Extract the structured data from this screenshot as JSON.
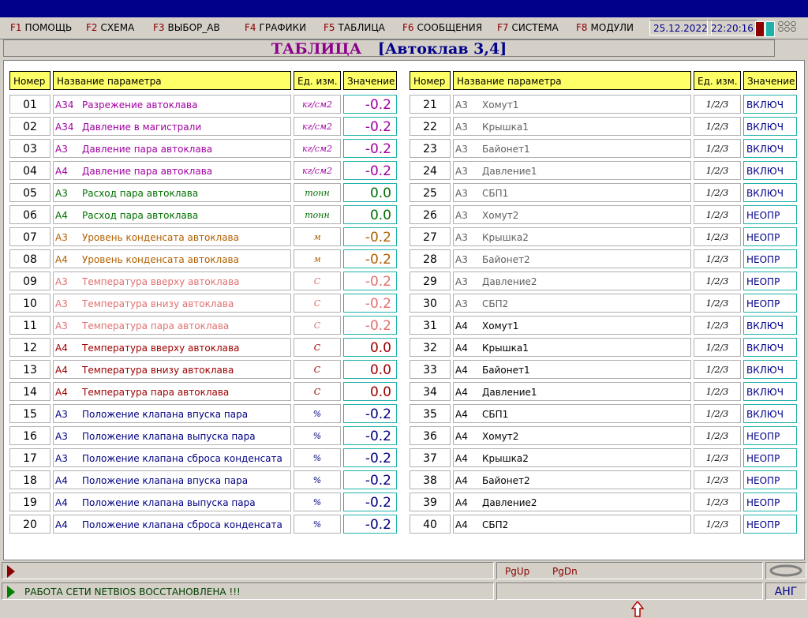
{
  "menu": {
    "items": [
      {
        "key": "F1",
        "label": "ПОМОЩЬ"
      },
      {
        "key": "F2",
        "label": "СХЕМА"
      },
      {
        "key": "F3",
        "label": "ВЫБОР_АВ"
      },
      {
        "key": "F4",
        "label": "ГРАФИКИ"
      },
      {
        "key": "F5",
        "label": "ТАБЛИЦА"
      },
      {
        "key": "F6",
        "label": "СООБЩЕНИЯ"
      },
      {
        "key": "F7",
        "label": "СИСТЕМА"
      },
      {
        "key": "F8",
        "label": "МОДУЛИ"
      }
    ],
    "date": "25.12.2022",
    "time": "22:20:16",
    "dots": "○○○ ○○○"
  },
  "title": {
    "main": "ТАБЛИЦА",
    "sub": "[Автоклав  3,4]"
  },
  "headers": {
    "num": "Номер",
    "name": "Название параметра",
    "unit": "Ед. изм.",
    "value": "Значение"
  },
  "colors": {
    "purple": "#a000a0",
    "green": "#007000",
    "orange": "#b06000",
    "pink": "#e07070",
    "darkred": "#a00000",
    "navy": "#000080",
    "gray": "#606060",
    "black": "#000000"
  },
  "left_rows": [
    {
      "num": "01",
      "group": "А34",
      "name": "Разрежение автоклава",
      "unit": "кг/см2",
      "value": "-0.2",
      "color": "purple"
    },
    {
      "num": "02",
      "group": "А34",
      "name": "Давление в магистрали",
      "unit": "кг/см2",
      "value": "-0.2",
      "color": "purple"
    },
    {
      "num": "03",
      "group": "А3",
      "name": "Давление пара автоклава",
      "unit": "кг/см2",
      "value": "-0.2",
      "color": "purple"
    },
    {
      "num": "04",
      "group": "А4",
      "name": "Давление пара автоклава",
      "unit": "кг/см2",
      "value": "-0.2",
      "color": "purple"
    },
    {
      "num": "05",
      "group": "А3",
      "name": "Расход пара автоклава",
      "unit": "тонн",
      "value": "0.0",
      "color": "green"
    },
    {
      "num": "06",
      "group": "А4",
      "name": "Расход пара автоклава",
      "unit": "тонн",
      "value": "0.0",
      "color": "green"
    },
    {
      "num": "07",
      "group": "А3",
      "name": "Уровень конденсата автоклава",
      "unit": "м",
      "value": "-0.2",
      "color": "orange"
    },
    {
      "num": "08",
      "group": "А4",
      "name": "Уровень конденсата автоклава",
      "unit": "м",
      "value": "-0.2",
      "color": "orange"
    },
    {
      "num": "09",
      "group": "А3",
      "name": "Температура вверху автоклава",
      "unit": "С",
      "value": "-0.2",
      "color": "pink"
    },
    {
      "num": "10",
      "group": "А3",
      "name": "Температура внизу автоклава",
      "unit": "С",
      "value": "-0.2",
      "color": "pink"
    },
    {
      "num": "11",
      "group": "А3",
      "name": "Температура пара автоклава",
      "unit": "С",
      "value": "-0.2",
      "color": "pink"
    },
    {
      "num": "12",
      "group": "А4",
      "name": "Температура вверху автоклава",
      "unit": "С",
      "value": "0.0",
      "color": "darkred"
    },
    {
      "num": "13",
      "group": "А4",
      "name": "Температура внизу автоклава",
      "unit": "С",
      "value": "0.0",
      "color": "darkred"
    },
    {
      "num": "14",
      "group": "А4",
      "name": "Температура пара автоклава",
      "unit": "С",
      "value": "0.0",
      "color": "darkred"
    },
    {
      "num": "15",
      "group": "А3",
      "name": "Положение клапана впуска пара",
      "unit": "%",
      "value": "-0.2",
      "color": "navy"
    },
    {
      "num": "16",
      "group": "А3",
      "name": "Положение клапана выпуска пара",
      "unit": "%",
      "value": "-0.2",
      "color": "navy"
    },
    {
      "num": "17",
      "group": "А3",
      "name": "Положение клапана сброса конденсата",
      "unit": "%",
      "value": "-0.2",
      "color": "navy"
    },
    {
      "num": "18",
      "group": "А4",
      "name": "Положение клапана впуска пара",
      "unit": "%",
      "value": "-0.2",
      "color": "navy"
    },
    {
      "num": "19",
      "group": "А4",
      "name": "Положение клапана выпуска пара",
      "unit": "%",
      "value": "-0.2",
      "color": "navy"
    },
    {
      "num": "20",
      "group": "А4",
      "name": "Положение клапана сброса конденсата",
      "unit": "%",
      "value": "-0.2",
      "color": "navy"
    }
  ],
  "right_rows": [
    {
      "num": "21",
      "group": "А3",
      "name": "Хомут1",
      "unit": "1/2/3",
      "value": "ВКЛЮЧ",
      "color": "gray"
    },
    {
      "num": "22",
      "group": "А3",
      "name": "Крышка1",
      "unit": "1/2/3",
      "value": "ВКЛЮЧ",
      "color": "gray"
    },
    {
      "num": "23",
      "group": "А3",
      "name": "Байонет1",
      "unit": "1/2/3",
      "value": "ВКЛЮЧ",
      "color": "gray"
    },
    {
      "num": "24",
      "group": "А3",
      "name": "Давление1",
      "unit": "1/2/3",
      "value": "ВКЛЮЧ",
      "color": "gray"
    },
    {
      "num": "25",
      "group": "А3",
      "name": "СБП1",
      "unit": "1/2/3",
      "value": "ВКЛЮЧ",
      "color": "gray"
    },
    {
      "num": "26",
      "group": "А3",
      "name": "Хомут2",
      "unit": "1/2/3",
      "value": "НЕОПР",
      "color": "gray"
    },
    {
      "num": "27",
      "group": "А3",
      "name": "Крышка2",
      "unit": "1/2/3",
      "value": "НЕОПР",
      "color": "gray"
    },
    {
      "num": "28",
      "group": "А3",
      "name": "Байонет2",
      "unit": "1/2/3",
      "value": "НЕОПР",
      "color": "gray"
    },
    {
      "num": "29",
      "group": "А3",
      "name": "Давление2",
      "unit": "1/2/3",
      "value": "НЕОПР",
      "color": "gray"
    },
    {
      "num": "30",
      "group": "А3",
      "name": "СБП2",
      "unit": "1/2/3",
      "value": "НЕОПР",
      "color": "gray"
    },
    {
      "num": "31",
      "group": "А4",
      "name": "Хомут1",
      "unit": "1/2/3",
      "value": "ВКЛЮЧ",
      "color": "black"
    },
    {
      "num": "32",
      "group": "А4",
      "name": "Крышка1",
      "unit": "1/2/3",
      "value": "ВКЛЮЧ",
      "color": "black"
    },
    {
      "num": "33",
      "group": "А4",
      "name": "Байонет1",
      "unit": "1/2/3",
      "value": "ВКЛЮЧ",
      "color": "black"
    },
    {
      "num": "34",
      "group": "А4",
      "name": "Давление1",
      "unit": "1/2/3",
      "value": "ВКЛЮЧ",
      "color": "black"
    },
    {
      "num": "35",
      "group": "А4",
      "name": "СБП1",
      "unit": "1/2/3",
      "value": "ВКЛЮЧ",
      "color": "black"
    },
    {
      "num": "36",
      "group": "А4",
      "name": "Хомут2",
      "unit": "1/2/3",
      "value": "НЕОПР",
      "color": "black"
    },
    {
      "num": "37",
      "group": "А4",
      "name": "Крышка2",
      "unit": "1/2/3",
      "value": "НЕОПР",
      "color": "black"
    },
    {
      "num": "38",
      "group": "А4",
      "name": "Байонет2",
      "unit": "1/2/3",
      "value": "НЕОПР",
      "color": "black"
    },
    {
      "num": "39",
      "group": "А4",
      "name": "Давление2",
      "unit": "1/2/3",
      "value": "НЕОПР",
      "color": "black"
    },
    {
      "num": "40",
      "group": "А4",
      "name": "СБП2",
      "unit": "1/2/3",
      "value": "НЕОПР",
      "color": "black"
    }
  ],
  "status": {
    "pgup": "PgUp",
    "pgdn": "PgDn",
    "message": "РАБОТА СЕТИ NETBIOS ВОССТАНОВЛЕНА !!!",
    "lang": "АНГ"
  }
}
